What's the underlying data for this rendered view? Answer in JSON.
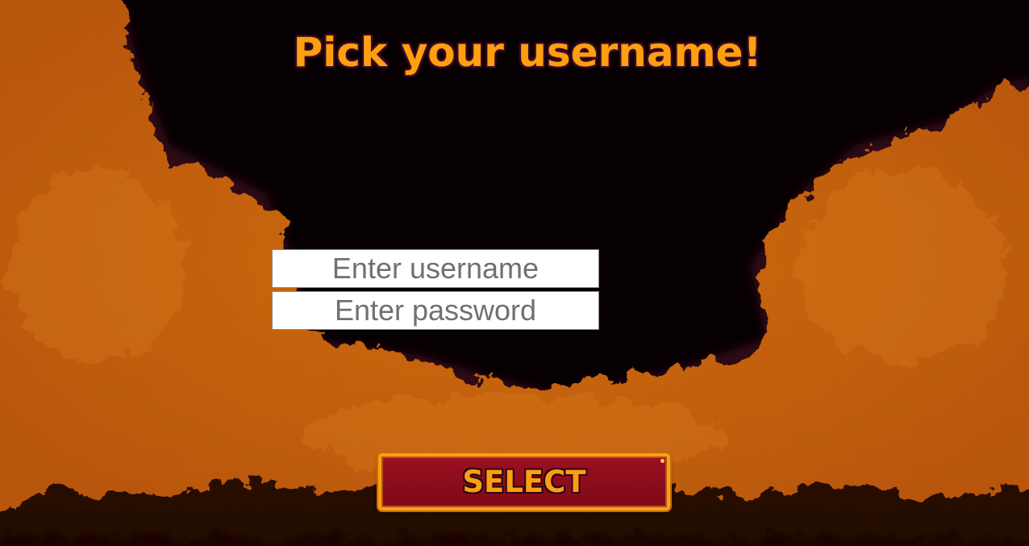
{
  "screen": {
    "title": "Pick your username!"
  },
  "form": {
    "username_placeholder": "Enter username",
    "password_placeholder": "Enter password",
    "select_label": "SELECT"
  },
  "colors": {
    "background": "#070002",
    "cloud_orange": "#c8640c",
    "title_orange": "#ff9f10",
    "button_red": "#8c0e1c",
    "button_border": "#ff9e10"
  }
}
